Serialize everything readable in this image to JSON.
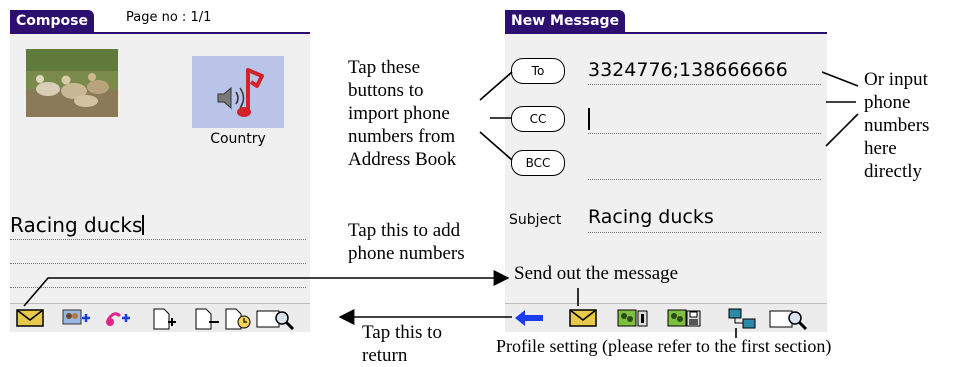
{
  "compose": {
    "tab_label": "Compose",
    "page_label": "Page no : 1/1",
    "music_label": "Country",
    "text_value": "Racing ducks"
  },
  "new_message": {
    "tab_label": "New Message",
    "to_label": "To",
    "cc_label": "CC",
    "bcc_label": "BCC",
    "to_value": "3324776;138666666",
    "cc_value": "",
    "subject_label": "Subject",
    "subject_value": "Racing ducks"
  },
  "annotations": {
    "import_buttons": [
      "Tap these",
      "buttons to",
      "import phone",
      "numbers from",
      "Address Book"
    ],
    "input_directly": [
      "Or input",
      "phone",
      "numbers",
      "here",
      "directly"
    ],
    "add_phone": [
      "Tap this to add",
      "phone numbers"
    ],
    "send_out": "Send out the message",
    "return": [
      "Tap this to",
      "return"
    ],
    "profile_setting": "Profile setting (please refer to the first section)"
  },
  "icons": {
    "compose_toolbar": [
      "envelope-icon",
      "add-group-icon",
      "add-music-icon",
      "new-page-icon",
      "remove-page-icon",
      "page-timer-icon",
      "preview-icon"
    ],
    "message_toolbar": [
      "back-arrow-icon",
      "send-envelope-icon",
      "save-profile-icon",
      "load-profile-icon",
      "profile-setting-icon",
      "preview-icon"
    ]
  },
  "colors": {
    "title_bar": "#2c0f6e",
    "back_arrow": "#1a3df0",
    "envelope": "#e6c84a",
    "music_tile": "#b9c4e8",
    "music_note": "#d2232a"
  }
}
